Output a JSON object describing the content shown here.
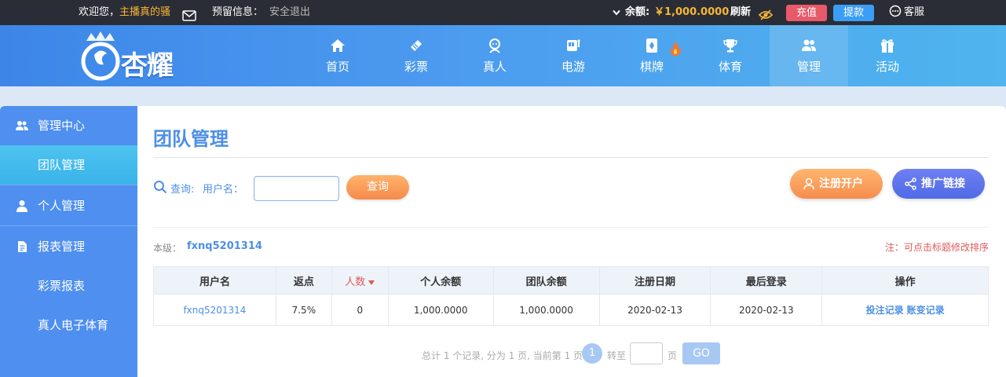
{
  "topbar": {
    "welcome_prefix": "欢迎您，",
    "username": "主播真的骚",
    "reserve_label": "预留信息：",
    "logout": "安全退出",
    "balance_label": "余额:",
    "balance": "￥1,000.0000",
    "refresh": "刷新",
    "recharge": "充值",
    "withdraw": "提款",
    "service": "客服"
  },
  "logo": {
    "text": "杏耀"
  },
  "nav": [
    {
      "label": "首页",
      "icon": "home-icon"
    },
    {
      "label": "彩票",
      "icon": "lottery-icon"
    },
    {
      "label": "真人",
      "icon": "live-dealer-icon"
    },
    {
      "label": "电游",
      "icon": "slot-machine-icon"
    },
    {
      "label": "棋牌",
      "icon": "cards-icon",
      "hot": true
    },
    {
      "label": "体育",
      "icon": "trophy-icon"
    },
    {
      "label": "管理",
      "icon": "users-icon",
      "active": true
    },
    {
      "label": "活动",
      "icon": "gift-icon"
    }
  ],
  "sidebar": {
    "items": [
      {
        "label": "管理中心",
        "icon": "group-icon"
      },
      {
        "label": "团队管理",
        "active": true
      },
      {
        "label": "个人管理",
        "icon": "user-icon"
      },
      {
        "label": "报表管理",
        "icon": "report-icon"
      },
      {
        "label": "彩票报表"
      },
      {
        "label": "真人电子体育"
      }
    ]
  },
  "main": {
    "title": "团队管理",
    "search_label": "查询:",
    "username_label": "用户名：",
    "username_value": "",
    "query_button": "查询",
    "register_button": "注册开户",
    "promo_button": "推广链接",
    "level_label": "本级：",
    "level_value": "fxnq5201314",
    "note": "注：可点击标题修改排序"
  },
  "table": {
    "headers": [
      "用户名",
      "返点",
      "人数",
      "个人余额",
      "团队余额",
      "注册日期",
      "最后登录",
      "操作"
    ],
    "rows": [
      {
        "username": "fxnq5201314",
        "rebate": "7.5%",
        "count": "0",
        "personal_balance": "1,000.0000",
        "team_balance": "1,000.0000",
        "reg_date": "2020-02-13",
        "last_login": "2020-02-13",
        "op_bets": "投注记录",
        "op_changes": "账变记录"
      }
    ]
  },
  "pager": {
    "summary": "总计 1 个记录, 分为 1 页, 当前第 1 页",
    "current": "1",
    "goto": "转至",
    "page": "页",
    "go": "GO"
  },
  "colors": {
    "accent": "#4d8fe6",
    "topbar_bg": "#2b2d36",
    "gold": "#f7b733",
    "recharge": "#e8596a",
    "withdraw": "#3b9ef5"
  }
}
